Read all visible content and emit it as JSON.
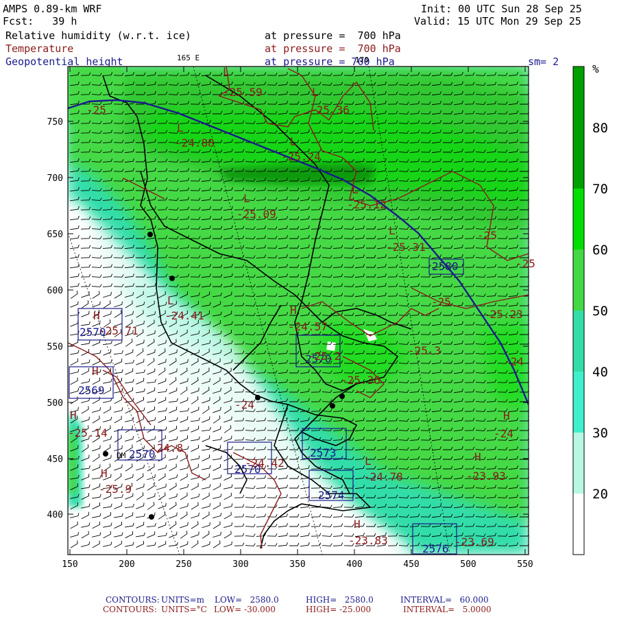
{
  "header": {
    "model": "AMPS 0.89-km WRF",
    "forecast": "Fcst:   39 h",
    "init": "Init: 00 UTC Sun 28 Sep 25",
    "valid": "Valid: 15 UTC Mon 29 Sep 25",
    "field1": "Relative humidity (w.r.t. ice)",
    "field2": "Temperature",
    "field3": "Geopotential height",
    "level1": "at pressure =  700 hPa",
    "level2": "at pressure =  700 hPa",
    "level3": "at pressure = 700 hPa",
    "meridian_165e": "165 E",
    "meridian_170e": "170",
    "smoothing": "sm= 2"
  },
  "colorbar": {
    "unit": "%",
    "ticks": [
      "80",
      "70",
      "60",
      "50",
      "40",
      "30",
      "20"
    ],
    "colors": [
      "#00a000",
      "#00e000",
      "#44d944",
      "#33ddaa",
      "#40f0cc",
      "#b8f7e4",
      "#ffffff"
    ]
  },
  "axes": {
    "x_ticks": [
      "150",
      "200",
      "250",
      "300",
      "350",
      "400",
      "450",
      "500",
      "550"
    ],
    "y_ticks": [
      "750",
      "700",
      "650",
      "600",
      "550",
      "500",
      "450",
      "400"
    ]
  },
  "temperature_labels": [
    "-25.59",
    "-25.36",
    "-24.88",
    "-25.24",
    "-25.09",
    "-25.12",
    "-25.31",
    "-25",
    "-25",
    "-25.23",
    "-24.57",
    "-25.3",
    "-24",
    "-25.36",
    "-24",
    "-25.14",
    "-24.8",
    "-25.9",
    "-24.78",
    "-23.93",
    "-23.83",
    "-23.69",
    "-25.2",
    "-24.41",
    "-24.42",
    "-25",
    "-25",
    "-25.71",
    "-24"
  ],
  "height_labels": [
    "2580",
    "2570",
    "2569",
    "2573",
    "2570",
    "2574",
    "2576",
    "2570",
    "2570"
  ],
  "hl_markers": [
    "L",
    "L",
    "L",
    "L",
    "L",
    "L",
    "L",
    "H",
    "H",
    "H",
    "H",
    "H",
    "H",
    "H",
    "H",
    "L",
    "L"
  ],
  "station_label": "DM",
  "footer": {
    "line1": {
      "name": "CONTOURS:",
      "units": "UNITS=m",
      "low": "LOW=   2580.0",
      "high": "HIGH=   2580.0",
      "interval": "INTERVAL=   60.000"
    },
    "line2": {
      "name": "CONTOURS:",
      "units": "UNITS=°C",
      "low": "LOW= -30.000",
      "high": "HIGH= -25.000",
      "interval": "INTERVAL=   5.0000"
    }
  }
}
